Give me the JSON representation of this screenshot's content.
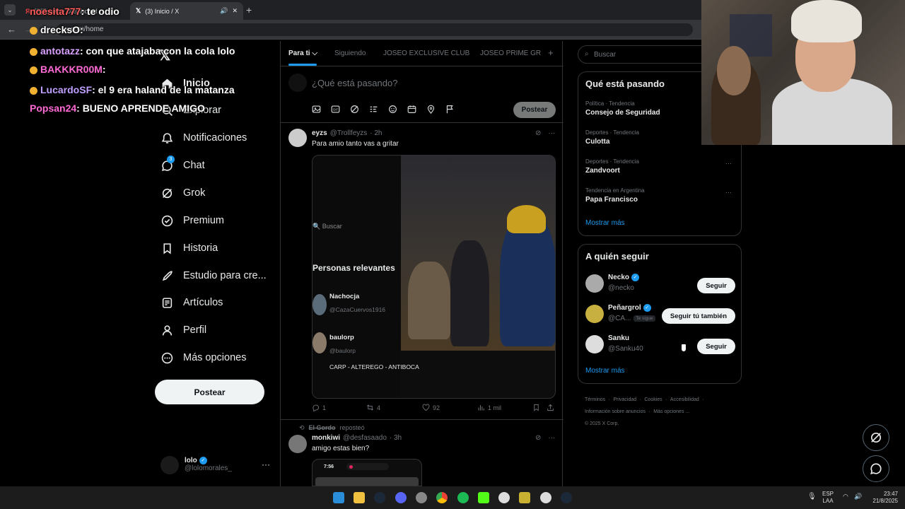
{
  "browser": {
    "tabs": [
      {
        "title": "[R]Toolkit • Dashboard"
      },
      {
        "title": "(3) Inicio / X"
      }
    ],
    "url": "x.com/home"
  },
  "nav": {
    "items": [
      {
        "label": "Inicio",
        "icon": "home-icon"
      },
      {
        "label": "Explorar",
        "icon": "search-icon"
      },
      {
        "label": "Notificaciones",
        "icon": "bell-icon"
      },
      {
        "label": "Chat",
        "icon": "chat-icon",
        "badge": "3"
      },
      {
        "label": "Grok",
        "icon": "grok-icon"
      },
      {
        "label": "Premium",
        "icon": "premium-icon"
      },
      {
        "label": "Historia",
        "icon": "bookmark-icon"
      },
      {
        "label": "Estudio para cre...",
        "icon": "rocket-icon"
      },
      {
        "label": "Artículos",
        "icon": "article-icon"
      },
      {
        "label": "Perfil",
        "icon": "person-icon"
      },
      {
        "label": "Más opciones",
        "icon": "more-circle-icon"
      }
    ],
    "post_button": "Postear",
    "account": {
      "name": "lolo",
      "handle": "@lolomorales_"
    }
  },
  "feed": {
    "tabs": [
      "Para ti",
      "Siguiendo",
      "JOSEO EXCLUSIVE CLUB",
      "JOSEO PRIME GR"
    ],
    "composer_placeholder": "¿Qué está pasando?",
    "composer_post": "Postear",
    "tweets": [
      {
        "name": "eyzs",
        "handle": "@Trollfeyzs",
        "time": "· 2h",
        "text": "Para amio tanto vas a gritar",
        "media": {
          "search_placeholder": "Buscar",
          "section_title": "Personas relevantes",
          "people": [
            {
              "name": "Nachocja",
              "handle": "@CazaCuervos1916"
            },
            {
              "name": "baulorp",
              "handle": "@baulorp",
              "bio": "CARP - ALTEREGO - ANTIBOCA"
            }
          ]
        },
        "stats": {
          "replies": "1",
          "reposts": "4",
          "likes": "92",
          "views": "1 mil"
        }
      },
      {
        "repost_by": "El Gordo",
        "repost_label": "reposteó",
        "name": "monkiwi",
        "handle": "@desfasaado",
        "time": "· 3h",
        "text": "amigo estas bien?",
        "phone_time": "7:56"
      }
    ]
  },
  "sidebar": {
    "search_placeholder": "Buscar",
    "trends_title": "Qué está pasando",
    "trends": [
      {
        "category": "Política · Tendencia",
        "name": "Consejo de Seguridad"
      },
      {
        "category": "Deportes · Tendencia",
        "name": "Culotta"
      },
      {
        "category": "Deportes · Tendencia",
        "name": "Zandvoort"
      },
      {
        "category": "Tendencia en Argentina",
        "name": "Papa Francisco"
      }
    ],
    "trends_more": "Mostrar más",
    "follow_title": "A quién seguir",
    "follow": [
      {
        "name": "Necko",
        "handle": "@necko",
        "button": "Seguir"
      },
      {
        "name": "Peñargrol",
        "handle": "@CA...",
        "follows_you": "Te sigue",
        "button": "Seguir tú también"
      },
      {
        "name": "Sanku",
        "handle": "@Sanku40",
        "button": "Seguir"
      }
    ],
    "follow_more": "Mostrar más",
    "footer": [
      "Términos",
      "Privacidad",
      "Cookies",
      "Accesibilidad",
      "Información sobre anuncios",
      "Más opciones ...",
      "© 2025 X Corp."
    ]
  },
  "chat_overlay": [
    {
      "user": "noesita777",
      "msg": ": te odio",
      "color": "#ff5a5a"
    },
    {
      "user": "drecksO",
      "msg": ":",
      "color": "#ffffff"
    },
    {
      "user": "antotazz",
      "msg": ": con que atajaba con la cola lolo",
      "color": "#d8a0ff"
    },
    {
      "user": "BAKKKR00M",
      "msg": ":",
      "color": "#ff6ad5"
    },
    {
      "user": "LucardoSF",
      "msg": ": el 9 era haland de la matanza",
      "color": "#c0a0ff"
    },
    {
      "user": "Popsan24",
      "msg": ": BUENO APRENDE AMIGO",
      "color": "#ff6ad5"
    }
  ],
  "taskbar": {
    "lang": "ESP",
    "layout": "LAA",
    "time": "23:47",
    "date": "21/8/2025"
  }
}
